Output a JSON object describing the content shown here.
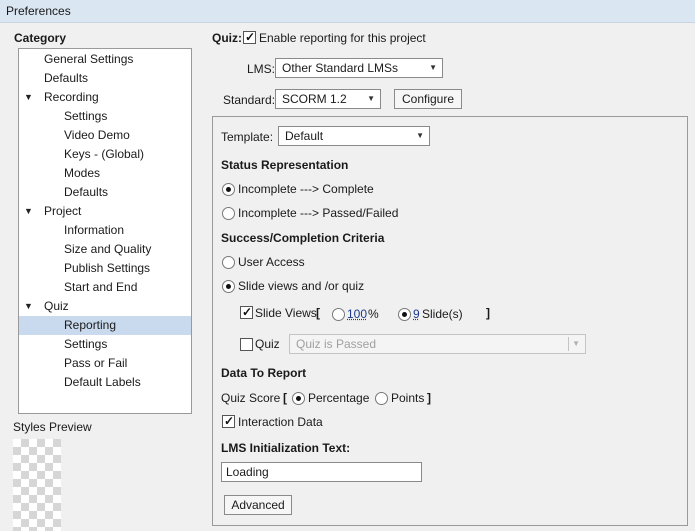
{
  "window": {
    "title": "Preferences"
  },
  "category": {
    "heading": "Category",
    "items": [
      {
        "label": "General Settings",
        "level": 0,
        "expandable": false,
        "selected": false
      },
      {
        "label": "Defaults",
        "level": 0,
        "expandable": false,
        "selected": false
      },
      {
        "label": "Recording",
        "level": 0,
        "expandable": true,
        "selected": false
      },
      {
        "label": "Settings",
        "level": 1,
        "expandable": false,
        "selected": false
      },
      {
        "label": "Video Demo",
        "level": 1,
        "expandable": false,
        "selected": false
      },
      {
        "label": "Keys - (Global)",
        "level": 1,
        "expandable": false,
        "selected": false
      },
      {
        "label": "Modes",
        "level": 1,
        "expandable": false,
        "selected": false
      },
      {
        "label": "Defaults",
        "level": 1,
        "expandable": false,
        "selected": false
      },
      {
        "label": "Project",
        "level": 0,
        "expandable": true,
        "selected": false
      },
      {
        "label": "Information",
        "level": 1,
        "expandable": false,
        "selected": false
      },
      {
        "label": "Size and Quality",
        "level": 1,
        "expandable": false,
        "selected": false
      },
      {
        "label": "Publish Settings",
        "level": 1,
        "expandable": false,
        "selected": false
      },
      {
        "label": "Start and End",
        "level": 1,
        "expandable": false,
        "selected": false
      },
      {
        "label": "Quiz",
        "level": 0,
        "expandable": true,
        "selected": false
      },
      {
        "label": "Reporting",
        "level": 1,
        "expandable": false,
        "selected": true
      },
      {
        "label": "Settings",
        "level": 1,
        "expandable": false,
        "selected": false
      },
      {
        "label": "Pass or Fail",
        "level": 1,
        "expandable": false,
        "selected": false
      },
      {
        "label": "Default Labels",
        "level": 1,
        "expandable": false,
        "selected": false
      }
    ]
  },
  "styles_preview": {
    "label": "Styles Preview"
  },
  "quiz": {
    "label": "Quiz:",
    "enable_reporting": {
      "label": "Enable reporting for this project",
      "checked": true
    }
  },
  "lms": {
    "label": "LMS:",
    "value": "Other Standard LMSs"
  },
  "standard": {
    "label": "Standard:",
    "value": "SCORM 1.2",
    "configure_label": "Configure"
  },
  "template": {
    "label": "Template:",
    "value": "Default"
  },
  "status_representation": {
    "heading": "Status Representation",
    "options": [
      {
        "label": "Incomplete ---> Complete",
        "selected": true
      },
      {
        "label": "Incomplete ---> Passed/Failed",
        "selected": false
      }
    ]
  },
  "criteria": {
    "heading": "Success/Completion Criteria",
    "user_access": {
      "label": "User Access",
      "selected": false
    },
    "slide_views_quiz": {
      "label": "Slide views and /or quiz",
      "selected": true
    },
    "slide_views": {
      "label": "Slide Views",
      "checked": true,
      "open_bracket": "[",
      "close_bracket": "]",
      "percent_value": "100",
      "percent_unit": "%",
      "percent_selected": false,
      "slides_value": "9",
      "slides_unit": "Slide(s)",
      "slides_selected": true
    },
    "quiz": {
      "label": "Quiz",
      "checked": false,
      "value": "Quiz is Passed"
    }
  },
  "data_to_report": {
    "heading": "Data To Report",
    "quiz_score_label": "Quiz Score",
    "open_bracket": "[",
    "close_bracket": "]",
    "percentage": {
      "label": "Percentage",
      "selected": true
    },
    "points": {
      "label": "Points",
      "selected": false
    },
    "interaction_data": {
      "label": "Interaction Data",
      "checked": true
    }
  },
  "lms_init": {
    "heading": "LMS Initialization Text:",
    "value": "Loading"
  },
  "advanced": {
    "label": "Advanced"
  },
  "icons": {
    "expand": "triangle-down-icon",
    "dropdown": "chevron-down-icon",
    "check": "checkmark-icon"
  }
}
